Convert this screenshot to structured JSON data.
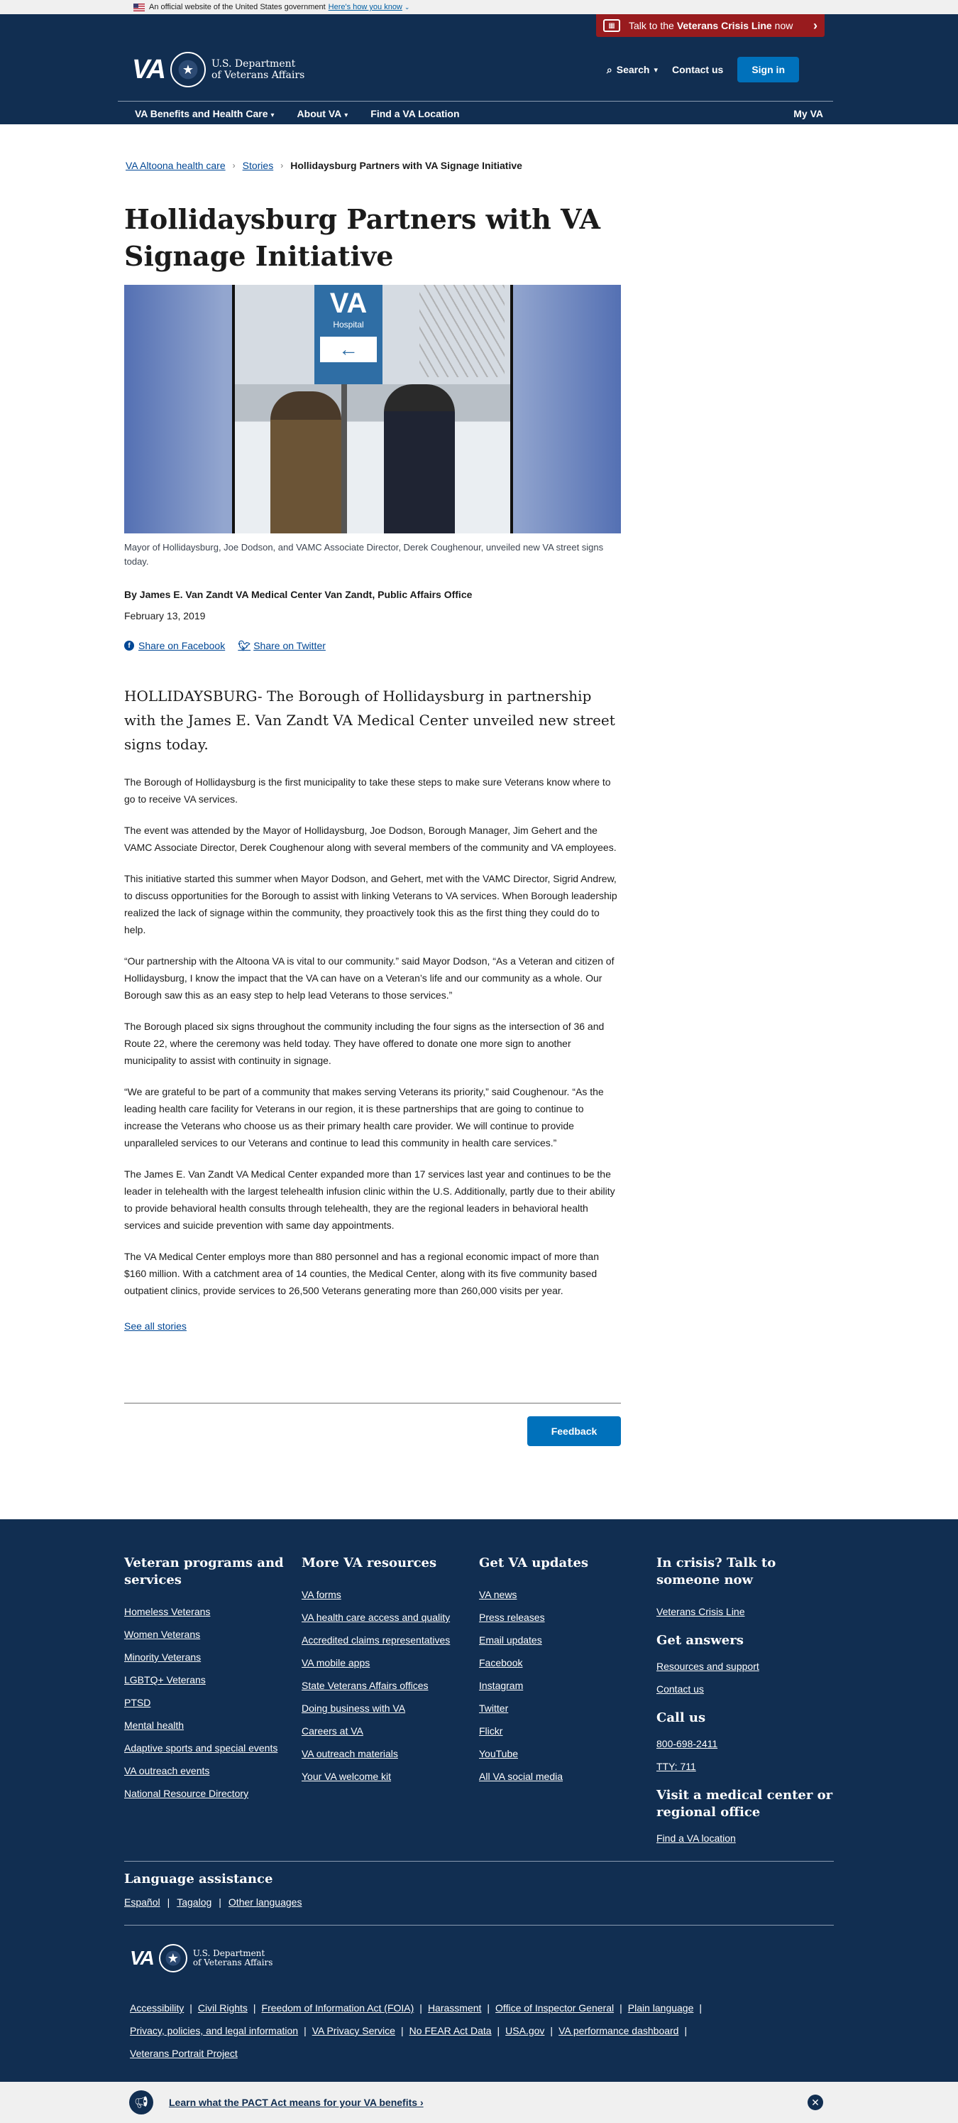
{
  "official": {
    "text": "An official website of the United States government",
    "link": "Here's how you know"
  },
  "crisis": {
    "pre": "Talk to the",
    "bold": "Veterans Crisis Line",
    "post": "now"
  },
  "header": {
    "logo_text": "VA",
    "dept_line1": "U.S. Department",
    "dept_line2": "of Veterans Affairs",
    "search": "Search",
    "contact": "Contact us",
    "signin": "Sign in"
  },
  "nav": {
    "items": [
      "VA Benefits and Health Care",
      "About VA",
      "Find a VA Location"
    ],
    "myva": "My VA"
  },
  "breadcrumb": [
    "VA Altoona health care",
    "Stories",
    "Hollidaysburg Partners with VA Signage Initiative"
  ],
  "article": {
    "title": "Hollidaysburg Partners with VA Signage Initiative",
    "photo_sign": "VA",
    "photo_sign_sub": "Hospital",
    "caption": "Mayor of Hollidaysburg, Joe Dodson, and VAMC Associate Director, Derek Coughenour, unveiled new VA street signs today.",
    "byline": "By James E. Van Zandt VA Medical Center Van Zandt, Public Affairs Office",
    "date": "February 13, 2019",
    "share_facebook": "Share on Facebook",
    "share_twitter": "Share on Twitter",
    "lead": "HOLLIDAYSBURG- The Borough of Hollidaysburg in partnership with the James E. Van Zandt VA Medical Center unveiled new street signs today.",
    "paragraphs": [
      "The Borough of Hollidaysburg is the first municipality to take these steps to make sure Veterans know where to go to receive VA services.",
      "The event was attended by the Mayor of Hollidaysburg, Joe Dodson, Borough Manager, Jim Gehert and the VAMC Associate Director, Derek Coughenour along with several members of the community and VA employees.",
      "This initiative started this summer when Mayor Dodson, and Gehert, met with the VAMC Director, Sigrid Andrew, to discuss opportunities for the Borough to assist with linking Veterans to VA services. When Borough leadership realized the lack of signage within the community, they proactively took this as the first thing they could do to help.",
      "“Our partnership with the Altoona VA is vital to our community.” said Mayor Dodson, “As a Veteran and citizen of Hollidaysburg, I know the impact that the VA can have on a Veteran’s life and our community as a whole. Our Borough saw this as an easy step to help lead Veterans to those services.”",
      "The Borough placed six signs throughout the community including the four signs as the intersection of 36 and Route 22, where the ceremony was held today. They have offered to donate one more sign to another municipality to assist with continuity in signage.",
      "“We are grateful to be part of a community that makes serving Veterans its priority,” said Coughenour. “As the leading health care facility for Veterans in our region, it is these partnerships that are going to continue to increase the Veterans who choose us as their primary health care provider. We will continue to provide unparalleled services to our Veterans and continue to lead this community in health care services.”",
      "The James E. Van Zandt VA Medical Center expanded more than 17 services last year and continues to be the leader in telehealth with the largest telehealth infusion clinic within the U.S. Additionally, partly due to their ability to provide behavioral health consults through telehealth, they are the regional leaders in behavioral health services and suicide prevention with same day appointments.",
      "The VA Medical Center employs more than 880 personnel and has a regional economic impact of more than $160 million. With a catchment area of 14 counties, the Medical Center, along with its five community based outpatient clinics, provide services to 26,500 Veterans generating more than 260,000 visits per year."
    ],
    "see_all": "See all stories",
    "feedback": "Feedback"
  },
  "footer": {
    "col1": {
      "title": "Veteran programs and services",
      "links": [
        "Homeless Veterans",
        "Women Veterans",
        "Minority Veterans",
        "LGBTQ+ Veterans",
        "PTSD",
        "Mental health",
        "Adaptive sports and special events",
        "VA outreach events",
        "National Resource Directory"
      ]
    },
    "col2": {
      "title": "More VA resources",
      "links": [
        "VA forms",
        "VA health care access and quality",
        "Accredited claims representatives",
        "VA mobile apps",
        "State Veterans Affairs offices",
        "Doing business with VA",
        "Careers at VA",
        "VA outreach materials",
        "Your VA welcome kit"
      ]
    },
    "col3": {
      "title": "Get VA updates",
      "links": [
        "VA news",
        "Press releases",
        "Email updates",
        "Facebook",
        "Instagram",
        "Twitter",
        "Flickr",
        "YouTube",
        "All VA social media"
      ]
    },
    "col4": {
      "crisis_title": "In crisis? Talk to someone now",
      "crisis_link": "Veterans Crisis Line",
      "answers_title": "Get answers",
      "answers_links": [
        "Resources and support",
        "Contact us"
      ],
      "call_title": "Call us",
      "call_links": [
        "800-698-2411",
        "TTY: 711"
      ],
      "visit_title": "Visit a medical center or regional office",
      "visit_link": "Find a VA location"
    },
    "language": {
      "title": "Language assistance",
      "links": [
        "Español",
        "Tagalog",
        "Other languages"
      ]
    },
    "bottom_links": [
      "Accessibility",
      "Civil Rights",
      "Freedom of Information Act (FOIA)",
      "Harassment",
      "Office of Inspector General",
      "Plain language",
      "Privacy, policies, and legal information",
      "VA Privacy Service",
      "No FEAR Act Data",
      "USA.gov",
      "VA performance dashboard",
      "Veterans Portrait Project"
    ]
  },
  "pact": {
    "text": "Learn what the PACT Act means for your VA benefits ›"
  },
  "colors": {
    "navy": "#112e51",
    "crisis_red": "#981b1e",
    "button_blue": "#0071bb",
    "link": "#004795"
  }
}
